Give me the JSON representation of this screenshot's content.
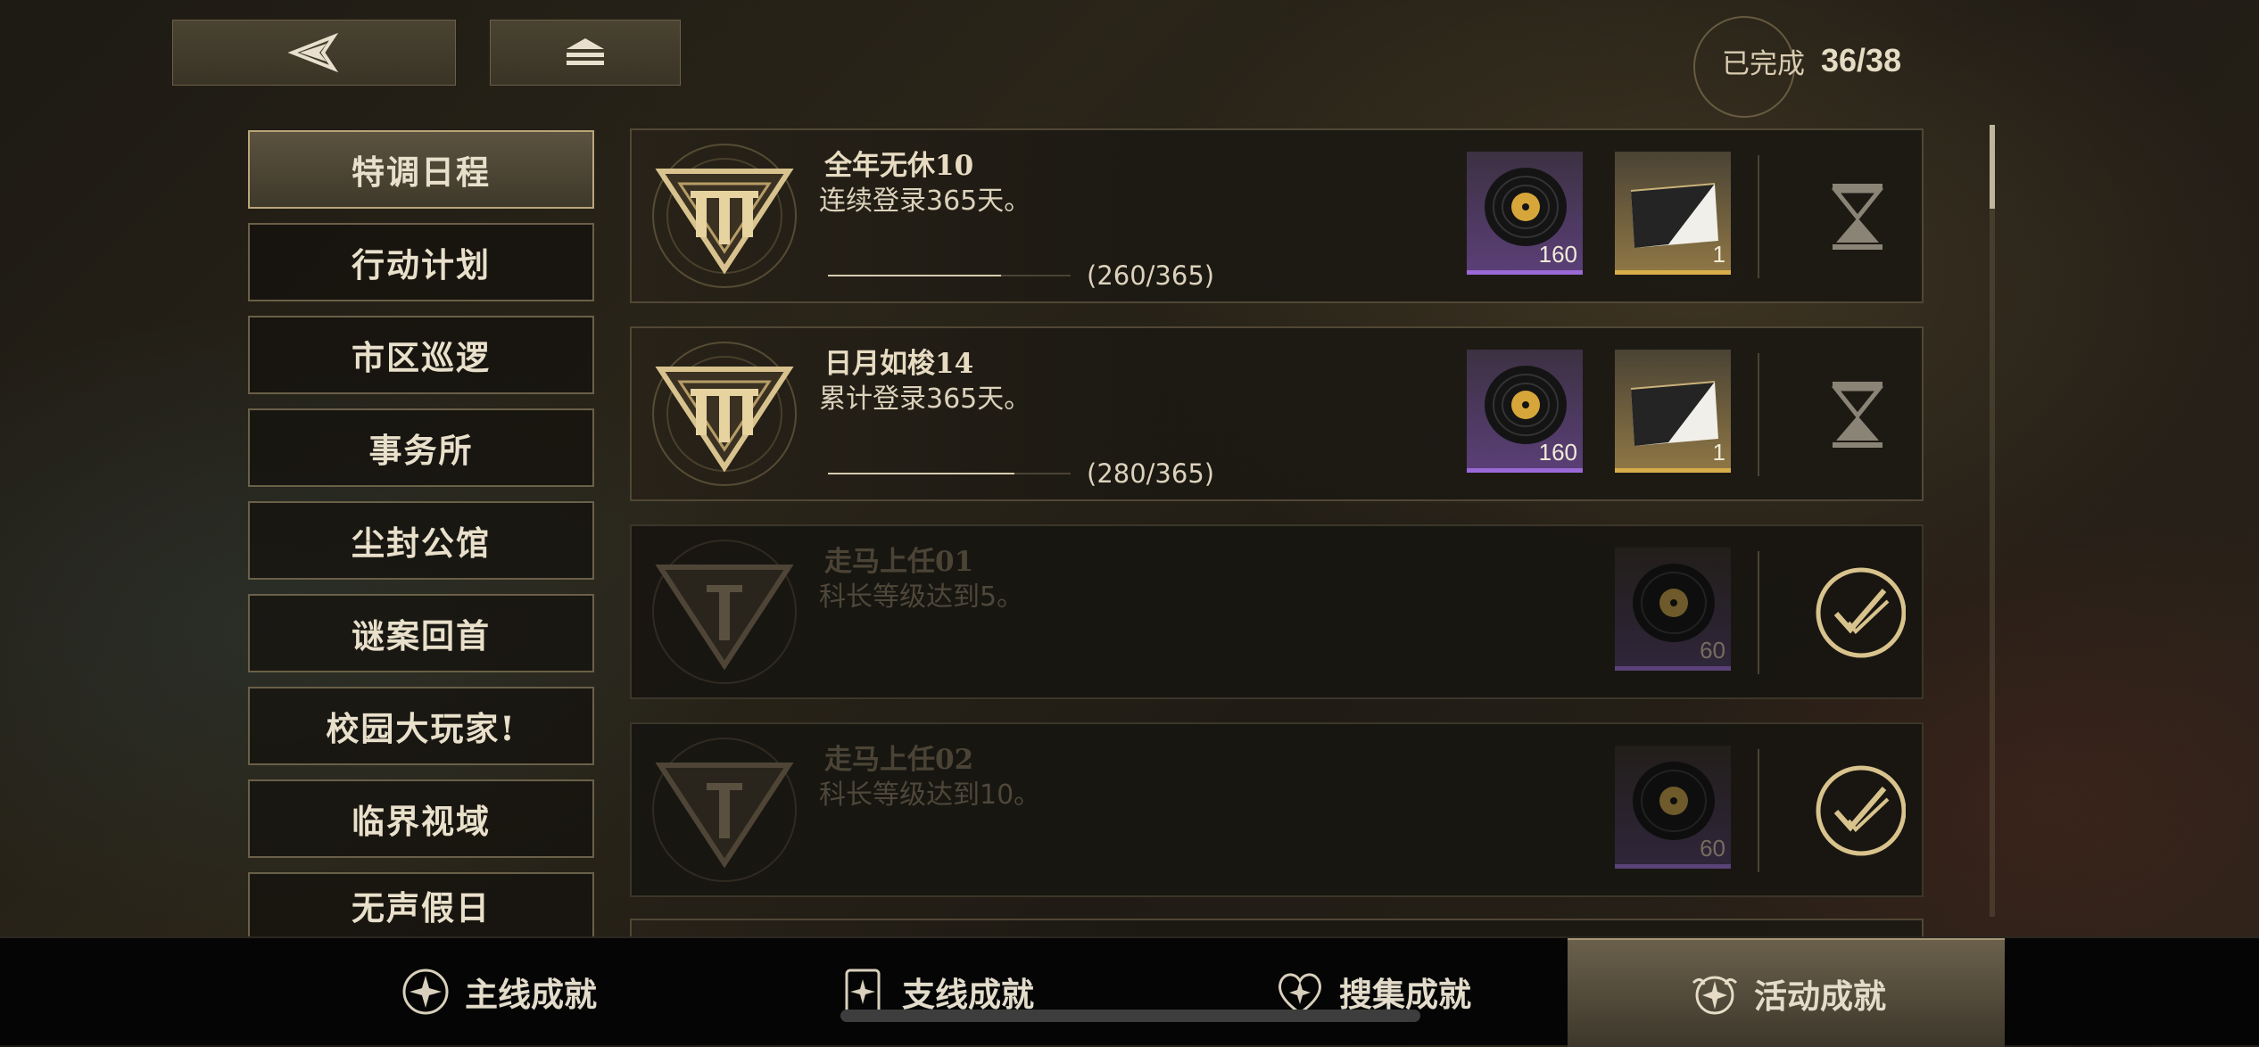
{
  "header": {
    "back_icon": "back-arrow-icon",
    "home_icon": "home-stack-icon",
    "completed_label": "已完成",
    "completed_count": "36/38"
  },
  "categories": [
    {
      "label": "特调日程",
      "active": true
    },
    {
      "label": "行动计划",
      "active": false
    },
    {
      "label": "市区巡逻",
      "active": false
    },
    {
      "label": "事务所",
      "active": false
    },
    {
      "label": "尘封公馆",
      "active": false
    },
    {
      "label": "谜案回首",
      "active": false
    },
    {
      "label": "校园大玩家!",
      "active": false
    },
    {
      "label": "临界视域",
      "active": false
    },
    {
      "label": "无声假日",
      "active": false
    }
  ],
  "achievements": [
    {
      "title": "全年无休10",
      "desc": "连续登录365天。",
      "progress_text": "(260/365)",
      "progress": 0.712,
      "rank": "III",
      "rewards": [
        {
          "type": "record",
          "qty": "160"
        },
        {
          "type": "card",
          "qty": "1"
        }
      ],
      "status": "in-progress"
    },
    {
      "title": "日月如梭14",
      "desc": "累计登录365天。",
      "progress_text": "(280/365)",
      "progress": 0.767,
      "rank": "III",
      "rewards": [
        {
          "type": "record",
          "qty": "160"
        },
        {
          "type": "card",
          "qty": "1"
        }
      ],
      "status": "in-progress"
    },
    {
      "title": "走马上任01",
      "desc": "科长等级达到5。",
      "rank": "I",
      "rewards": [
        {
          "type": "record",
          "qty": "60"
        }
      ],
      "status": "completed"
    },
    {
      "title": "走马上任02",
      "desc": "科长等级达到10。",
      "rank": "I",
      "rewards": [
        {
          "type": "record",
          "qty": "60"
        }
      ],
      "status": "completed"
    }
  ],
  "bottom_tabs": [
    {
      "label": "主线成就",
      "icon": "main-achievement-icon",
      "active": false
    },
    {
      "label": "支线成就",
      "icon": "side-achievement-icon",
      "active": false
    },
    {
      "label": "搜集成就",
      "icon": "collection-achievement-icon",
      "active": false
    },
    {
      "label": "活动成就",
      "icon": "event-achievement-icon",
      "active": true
    }
  ],
  "colors": {
    "accent_gold": "#d8c38e",
    "purple_rarity": "#9a69d6",
    "gold_rarity": "#d8ae4a"
  }
}
